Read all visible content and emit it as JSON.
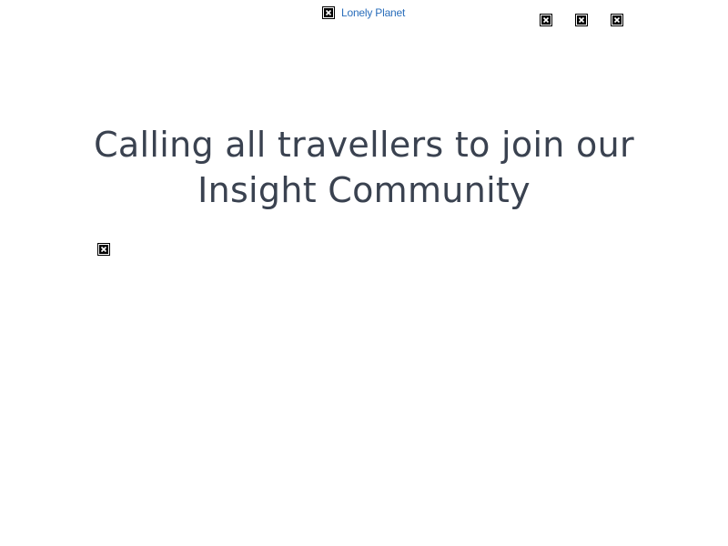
{
  "header": {
    "logo_label": "Lonely Planet",
    "icons": [
      {
        "name": "broken-image-icon"
      },
      {
        "name": "broken-image-icon"
      },
      {
        "name": "broken-image-icon"
      }
    ]
  },
  "main": {
    "headline_line1": "Calling all travellers to join our",
    "headline_line2": "Insight Community"
  },
  "colors": {
    "link": "#2a6ebb",
    "headline": "#3a4250",
    "background": "#ffffff"
  }
}
